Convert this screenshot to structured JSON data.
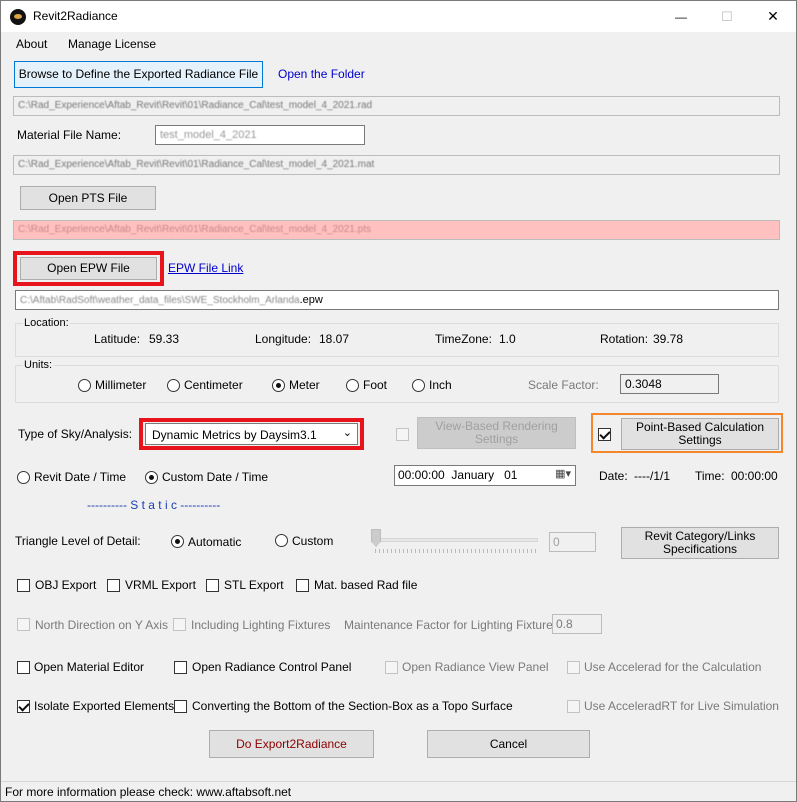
{
  "window": {
    "title": "Revit2Radiance",
    "controls": {
      "minimize": "—",
      "maximize": "☐",
      "close": "✕"
    }
  },
  "menu": {
    "about": "About",
    "manage_license": "Manage License"
  },
  "export": {
    "browse_label": "Browse to Define the Exported Radiance File",
    "open_folder_label": "Open the Folder",
    "rad_path": "C:\\Rad_Experience\\Aftab_Revit\\Revit\\01\\Radiance_Cal\\test_model_4_2021.rad"
  },
  "material": {
    "label": "Material File Name:",
    "name_value": "test_model_4_2021",
    "path": "C:\\Rad_Experience\\Aftab_Revit\\Revit\\01\\Radiance_Cal\\test_model_4_2021.mat"
  },
  "pts": {
    "button_label": "Open PTS File",
    "path": "C:\\Rad_Experience\\Aftab_Revit\\Revit\\01\\Radiance_Cal\\test_model_4_2021.pts"
  },
  "epw": {
    "button_label": "Open EPW File",
    "link_label": "EPW File Link",
    "path_blurred": "C:\\Aftab\\RadSoft\\weather_data_files\\SWE_Stockholm_Arlanda",
    "path_ext": ".epw"
  },
  "location": {
    "group_label": "Location:",
    "latitude_label": "Latitude:",
    "latitude": "59.33",
    "longitude_label": "Longitude:",
    "longitude": "18.07",
    "timezone_label": "TimeZone:",
    "timezone": "1.0",
    "rotation_label": "Rotation:",
    "rotation": "39.78"
  },
  "units": {
    "group_label": "Units:",
    "options": [
      "Millimeter",
      "Centimeter",
      "Meter",
      "Foot",
      "Inch"
    ],
    "selected": "Meter",
    "scale_label": "Scale Factor:",
    "scale_value": "0.3048"
  },
  "sky": {
    "label": "Type of Sky/Analysis:",
    "selected": "Dynamic Metrics by Daysim3.1",
    "view_based_label": "View-Based Rendering Settings",
    "point_based_label": "Point-Based Calculation Settings",
    "point_based_checked": true
  },
  "datetime": {
    "revit_label": "Revit Date / Time",
    "custom_label": "Custom Date / Time",
    "selected": "custom",
    "picker_time": "00:00:00",
    "picker_month": "January",
    "picker_day": "01",
    "date_label": "Date:",
    "date_value": "----/1/1",
    "time_label": "Time:",
    "time_value": "00:00:00",
    "static_label": "---------- S t a t i c ----------"
  },
  "detail": {
    "label": "Triangle Level of Detail:",
    "automatic_label": "Automatic",
    "custom_label": "Custom",
    "selected": "automatic",
    "custom_value": "0",
    "revit_category_label": "Revit Category/Links Specifications"
  },
  "exports": {
    "obj": "OBJ Export",
    "vrml": "VRML Export",
    "stl": "STL Export",
    "mat_based": "Mat. based Rad file"
  },
  "lighting": {
    "north_label": "North Direction on Y Axis",
    "fixtures_label": "Including Lighting Fixtures",
    "maintenance_label": "Maintenance Factor for Lighting Fixtures:",
    "maintenance_value": "0.8"
  },
  "options": {
    "material_editor": "Open Material Editor",
    "control_panel": "Open Radiance Control Panel",
    "view_panel": "Open Radiance View Panel",
    "accelerad": "Use Accelerad for the Calculation",
    "isolate": "Isolate Exported Elements",
    "isolate_checked": true,
    "section_box": "Converting the Bottom of the Section-Box as a Topo Surface",
    "acceleradrt": "Use AcceleradRT for Live Simulation"
  },
  "actions": {
    "export_label": "Do Export2Radiance",
    "cancel_label": "Cancel"
  },
  "status": {
    "text": "For more information please check: www.aftabsoft.net"
  },
  "colors": {
    "highlight_red": "#e8141c",
    "highlight_orange": "#f5862b",
    "link": "#0000cc",
    "pts_field": "#ffc0c0"
  }
}
